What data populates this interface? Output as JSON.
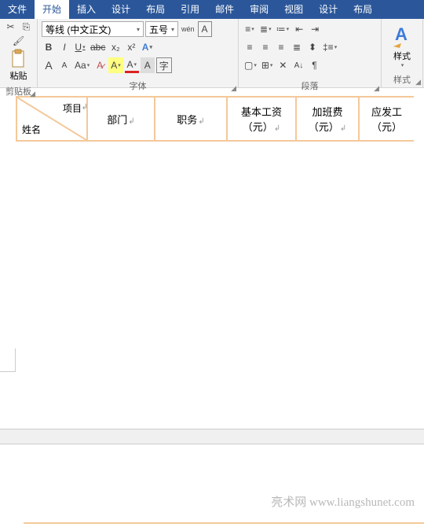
{
  "tabs": [
    "文件",
    "开始",
    "插入",
    "设计",
    "布局",
    "引用",
    "邮件",
    "审阅",
    "视图",
    "设计",
    "布局"
  ],
  "active_tab": 1,
  "clipboard": {
    "paste": "粘贴",
    "label": "剪贴板"
  },
  "font": {
    "name": "等线 (中文正文)",
    "size": "五号",
    "pinyin": "wén",
    "boxed": [
      "A"
    ],
    "bold": "B",
    "italic": "I",
    "underline": "U",
    "strike": "abc",
    "sub": "x₂",
    "sup": "x²",
    "bigA": "A",
    "smallA": "A",
    "aa": "Aa",
    "clearA": "A",
    "hlA": "A",
    "colorA": "A",
    "label": "字体"
  },
  "para": {
    "az": "A",
    "z": "Z",
    "arrows": "↓",
    "show": "¶",
    "label": "段落"
  },
  "styles": {
    "btn": "样式",
    "label": "样式"
  },
  "table": {
    "diag_top": "项目",
    "diag_bot": "姓名",
    "headers": [
      "部门",
      "职务",
      "基本工资\n（元）",
      "加班费\n（元）",
      "应发工\n（元）"
    ]
  },
  "watermark": "亮术网 www.liangshunet.com"
}
